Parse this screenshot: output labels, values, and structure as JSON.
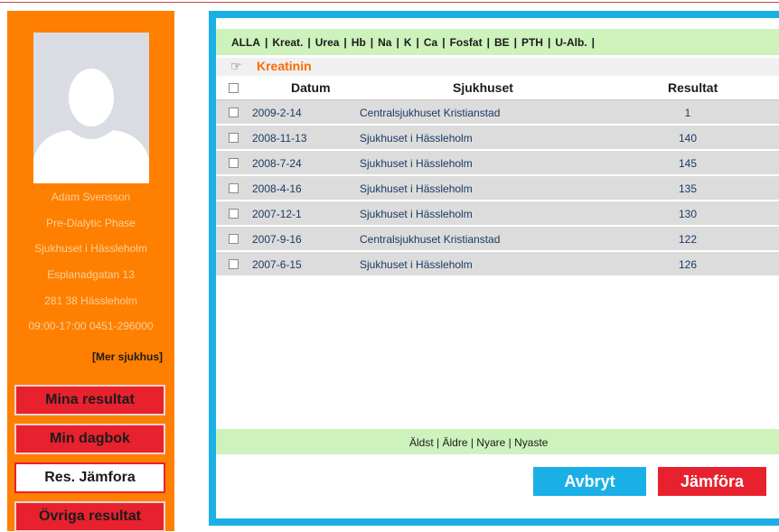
{
  "sidebar": {
    "patient_name": "Adam Svensson",
    "phase": "Pre-Dialytic Phase",
    "hospital": "Sjukhuset i Hässleholm",
    "street": "Esplanadgatan 13",
    "postal": "281 38  Hässleholm",
    "hours_phone": "09:00-17:00  0451-296000",
    "more_link": "[Mer sjukhus]",
    "nav": [
      {
        "label": "Mina resultat",
        "active": false
      },
      {
        "label": "Min dagbok",
        "active": false
      },
      {
        "label": "Res. Jämfora",
        "active": true
      },
      {
        "label": "Övriga resultat",
        "active": false
      }
    ]
  },
  "tabs": [
    "ALLA",
    "Kreat.",
    "Urea",
    "Hb",
    "Na",
    "K",
    "Ca",
    "Fosfat",
    "BE",
    "PTH",
    "U-Alb."
  ],
  "section_title": "Kreatinin",
  "table": {
    "headers": {
      "datum": "Datum",
      "sjukhuset": "Sjukhuset",
      "resultat": "Resultat"
    },
    "rows": [
      {
        "datum": "2009-2-14",
        "sjukhuset": "Centralsjukhuset Kristianstad",
        "resultat": "1"
      },
      {
        "datum": "2008-11-13",
        "sjukhuset": "Sjukhuset i Hässleholm",
        "resultat": "140"
      },
      {
        "datum": "2008-7-24",
        "sjukhuset": "Sjukhuset i Hässleholm",
        "resultat": "145"
      },
      {
        "datum": "2008-4-16",
        "sjukhuset": "Sjukhuset i Hässleholm",
        "resultat": "135"
      },
      {
        "datum": "2007-12-1",
        "sjukhuset": "Sjukhuset i Hässleholm",
        "resultat": "130"
      },
      {
        "datum": "2007-9-16",
        "sjukhuset": "Centralsjukhuset Kristianstad",
        "resultat": "122"
      },
      {
        "datum": "2007-6-15",
        "sjukhuset": "Sjukhuset i Hässleholm",
        "resultat": "126"
      }
    ]
  },
  "pager": {
    "oldest": "Äldst",
    "older": "Äldre",
    "newer": "Nyare",
    "newest": "Nyaste"
  },
  "buttons": {
    "cancel": "Avbryt",
    "compare": "Jämföra"
  },
  "colors": {
    "sidebar": "#ff7f00",
    "frame": "#1ab0e5",
    "accent_red": "#e8212e",
    "bar_green": "#cdf2bc"
  }
}
